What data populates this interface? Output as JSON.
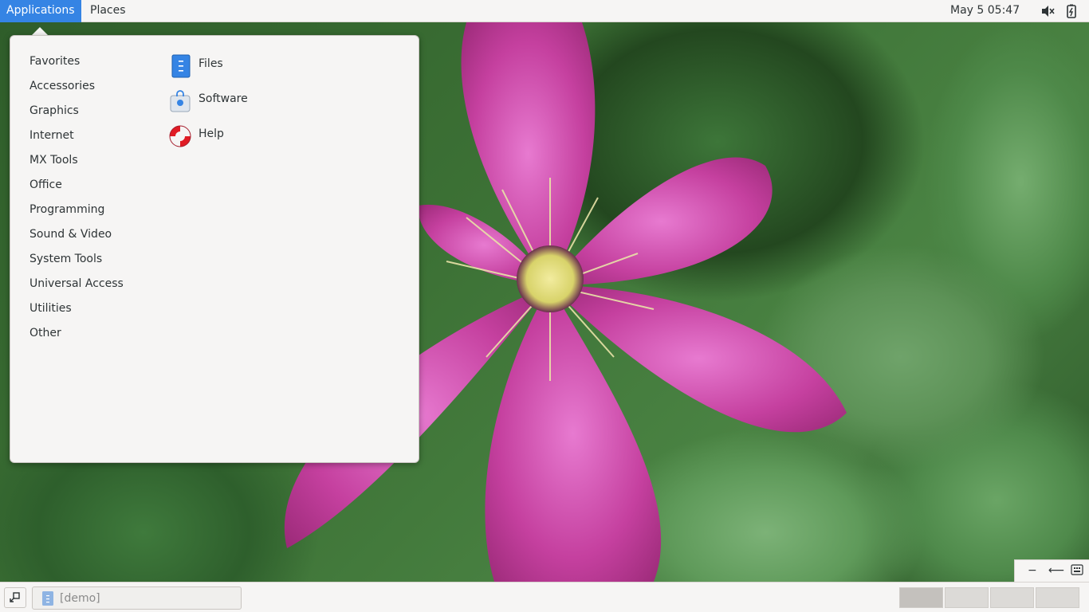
{
  "topbar": {
    "applications_label": "Applications",
    "places_label": "Places",
    "clock": "May 5  05:47",
    "tray_icons": [
      "volume-muted-icon",
      "battery-icon"
    ]
  },
  "menu": {
    "categories": [
      "Favorites",
      "Accessories",
      "Graphics",
      "Internet",
      "MX Tools",
      "Office",
      "Programming",
      "Sound & Video",
      "System Tools",
      "Universal Access",
      "Utilities",
      "Other"
    ],
    "apps": [
      {
        "label": "Files",
        "icon": "files-icon"
      },
      {
        "label": "Software",
        "icon": "software-icon"
      },
      {
        "label": "Help",
        "icon": "help-lifebuoy-icon"
      }
    ]
  },
  "taskbar": {
    "window_title": "[demo]",
    "workspaces": 4,
    "active_workspace": 1
  },
  "colors": {
    "accent": "#3584e4",
    "panel_bg": "#f6f5f4",
    "text": "#2e3436"
  }
}
